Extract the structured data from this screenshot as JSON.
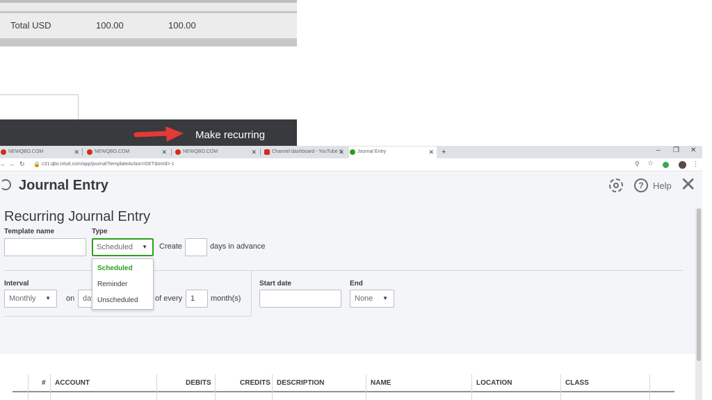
{
  "background": {
    "total_label": "Total USD",
    "total_debits": "100.00",
    "total_credits": "100.00",
    "annotation": "Make recurring",
    "accent_arrow_color": "#e53935"
  },
  "browser": {
    "tabs": [
      {
        "title": "NEWQBO.COM",
        "icon": "qbo-favicon"
      },
      {
        "title": "NEWQBO.COM",
        "icon": "qbo-favicon"
      },
      {
        "title": "NEWQBO.COM",
        "icon": "qbo-favicon"
      },
      {
        "title": "Channel dashboard - YouTube S",
        "icon": "youtube-favicon"
      },
      {
        "title": "Journal Entry",
        "icon": "quickbooks-favicon"
      }
    ],
    "new_tab": "+",
    "url": "c31.qbo.intuit.com/app/journal?templateAction=GET&tmId=-1",
    "window_controls": {
      "minimize": "–",
      "restore": "❐",
      "close": "✕"
    }
  },
  "header": {
    "title": "Journal Entry",
    "help_label": "Help"
  },
  "recurring": {
    "section_title": "Recurring Journal Entry",
    "template_name_label": "Template name",
    "template_name_value": "",
    "type_label": "Type",
    "type_value": "Scheduled",
    "type_options": [
      "Scheduled",
      "Reminder",
      "Unscheduled"
    ],
    "create_label": "Create",
    "create_value": "",
    "days_in_advance_label": "days in advance",
    "interval_label": "Interval",
    "interval_value": "Monthly",
    "on_label": "on",
    "on_value": "day",
    "of_every_label": "of every",
    "of_every_value": "1",
    "months_label": "month(s)",
    "start_date_label": "Start date",
    "start_date_value": "",
    "end_label": "End",
    "end_value": "None"
  },
  "table": {
    "columns": [
      "#",
      "ACCOUNT",
      "DEBITS",
      "CREDITS",
      "DESCRIPTION",
      "NAME",
      "LOCATION",
      "CLASS"
    ]
  },
  "colors": {
    "brand_green": "#2ca01c",
    "dark_footer": "#393a3d"
  }
}
